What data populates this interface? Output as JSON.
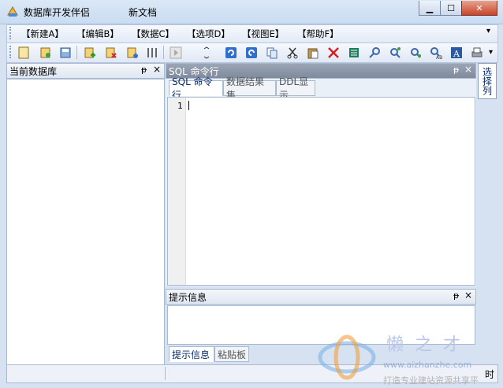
{
  "window": {
    "app_title": "数据库开发伴侣",
    "doc_title": "新文档",
    "minimize": "▁",
    "maximize": "☐",
    "close": "✕"
  },
  "menu": [
    "【新建A】",
    "【编辑B】",
    "【数据C】",
    "【选项D】",
    "【视图E】",
    "【帮助F】"
  ],
  "left_panel": {
    "title": "当前数据库",
    "pin": "ᵽ",
    "close": "×"
  },
  "sql_panel": {
    "title": "SQL 命令行",
    "pin": "ᵽ",
    "close": "×",
    "tabs": [
      "SQL 命令行",
      "数据结果集",
      "DDL显示"
    ],
    "line_number": "1"
  },
  "info_panel": {
    "title": "提示信息",
    "pin": "ᵽ",
    "close": "×",
    "tabs": [
      "提示信息",
      "粘贴板"
    ]
  },
  "side_tab": "选择列",
  "status": {
    "right_text": "时"
  },
  "watermark": {
    "text": "懒之才",
    "url": "www.aizhanzhe.com",
    "tagline": "打造专业建站资源共享平"
  },
  "colors": {
    "accent": "#0a2d6b",
    "panel_border": "#a9b9d0",
    "bg": "#d6e2f1"
  }
}
